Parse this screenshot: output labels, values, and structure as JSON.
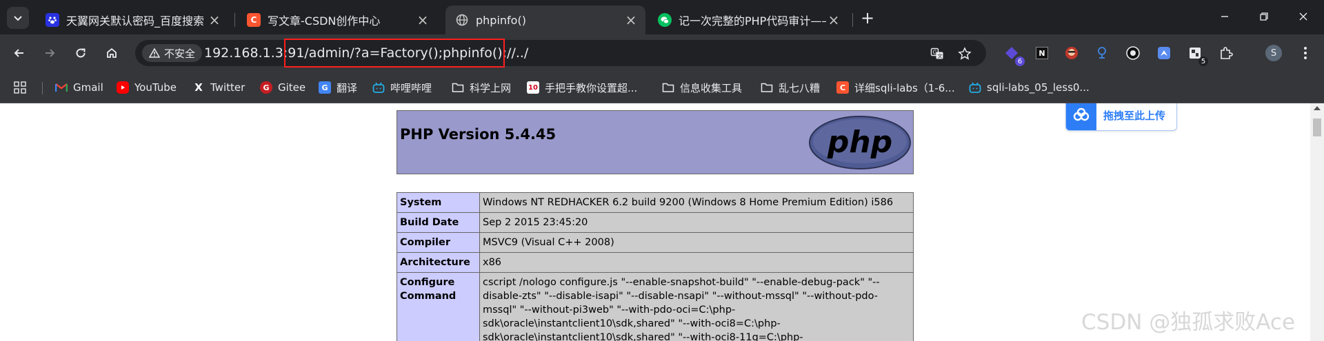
{
  "tabs": [
    {
      "title": "天翼网关默认密码_百度搜索",
      "favicon": "baidu-paw-icon",
      "active": false
    },
    {
      "title": "写文章-CSDN创作中心",
      "favicon": "csdn-c-icon",
      "active": false
    },
    {
      "title": "phpinfo()",
      "favicon": "globe-icon",
      "active": true
    },
    {
      "title": "记一次完整的PHP代码审计——",
      "favicon": "wechat-icon",
      "active": false
    }
  ],
  "omnibox": {
    "security_label": "不安全",
    "url_host": "192.168.1.3:91",
    "url_path": "/admin/?a=Factory();phpinfo();//../"
  },
  "extensions": [
    {
      "icon": "extension-purple-icon",
      "badge": "6"
    },
    {
      "icon": "extension-n-icon"
    },
    {
      "icon": "extension-avatar-icon"
    },
    {
      "icon": "extension-pin-icon"
    },
    {
      "icon": "extension-circle-icon"
    },
    {
      "icon": "extension-bird-icon"
    },
    {
      "icon": "extension-screen-icon",
      "badge": "5"
    },
    {
      "icon": "extensions-puzzle-icon"
    }
  ],
  "profile": {
    "initial": "S"
  },
  "bookmarks": [
    {
      "label": "Gmail",
      "icon": "gmail-icon"
    },
    {
      "label": "YouTube",
      "icon": "youtube-icon"
    },
    {
      "label": "Twitter",
      "icon": "x-icon"
    },
    {
      "label": "Gitee",
      "icon": "gitee-icon"
    },
    {
      "label": "翻译",
      "icon": "translate-icon"
    },
    {
      "label": "哔哩哔哩",
      "icon": "bilibili-icon"
    },
    {
      "label": "科学上网",
      "icon": "folder-icon"
    },
    {
      "label": "手把手教你设置超...",
      "icon": "bookmark-10-icon"
    },
    {
      "label": "信息收集工具",
      "icon": "folder-icon"
    },
    {
      "label": "乱七八糟",
      "icon": "folder-icon"
    },
    {
      "label": "详细sqli-labs（1-6...",
      "icon": "csdn-c-icon"
    },
    {
      "label": "sqli-labs_05_less0...",
      "icon": "bilibili-icon"
    }
  ],
  "phpinfo": {
    "version": "PHP Version 5.4.45",
    "logo_text": "php",
    "rows": [
      {
        "key": "System",
        "value": "Windows NT REDHACKER 6.2 build 9200 (Windows 8 Home Premium Edition) i586"
      },
      {
        "key": "Build Date",
        "value": "Sep 2 2015 23:45:20"
      },
      {
        "key": "Compiler",
        "value": "MSVC9 (Visual C++ 2008)"
      },
      {
        "key": "Architecture",
        "value": "x86"
      },
      {
        "key": "Configure Command",
        "value": "cscript /nologo configure.js \"--enable-snapshot-build\" \"--enable-debug-pack\" \"--disable-zts\" \"--disable-isapi\" \"--disable-nsapi\" \"--without-mssql\" \"--without-pdo-mssql\" \"--without-pi3web\" \"--with-pdo-oci=C:\\php-sdk\\oracle\\instantclient10\\sdk,shared\" \"--with-oci8=C:\\php-sdk\\oracle\\instantclient10\\sdk,shared\" \"--with-oci8-11g=C:\\php-"
      }
    ]
  },
  "upload_widget": {
    "label": "拖拽至此上传"
  },
  "watermark": "CSDN @独孤求败Ace",
  "colors": {
    "tabstrip_bg": "#202124",
    "toolbar_bg": "#35363a",
    "php_header": "#9999cc",
    "php_key_cell": "#ccccff",
    "php_value_cell": "#cccccc",
    "highlight_box": "#ff1f1f"
  }
}
